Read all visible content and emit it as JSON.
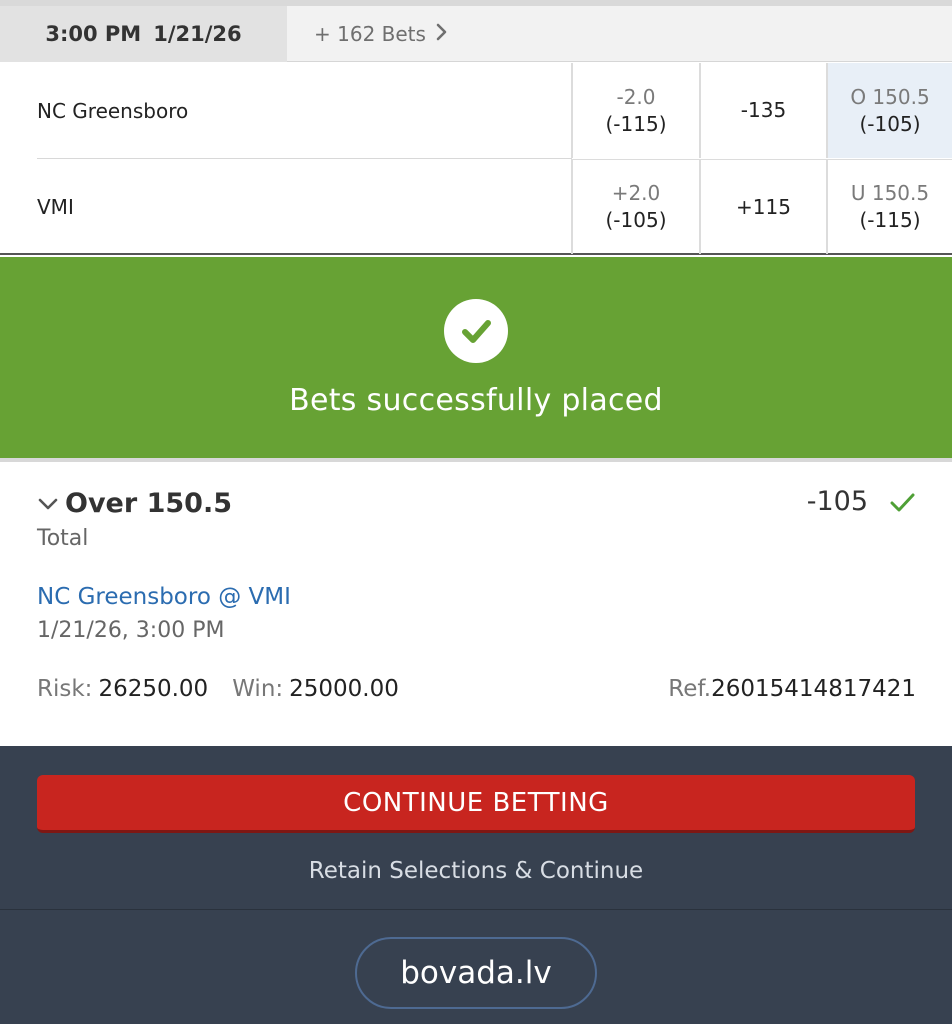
{
  "header": {
    "time": "3:00 PM",
    "date": "1/21/26",
    "more_bets": "+ 162 Bets"
  },
  "odds_table": {
    "rows": [
      {
        "team": "NC Greensboro",
        "spread_points": "-2.0",
        "spread_price": "(-115)",
        "moneyline": "-135",
        "total_points": "O 150.5",
        "total_price": "(-105)",
        "total_selected": true
      },
      {
        "team": "VMI",
        "spread_points": "+2.0",
        "spread_price": "(-105)",
        "moneyline": "+115",
        "total_points": "U 150.5",
        "total_price": "(-115)",
        "total_selected": false
      }
    ]
  },
  "banner": {
    "message": "Bets successfully placed",
    "icon": "check-circle-icon",
    "color": "#67a234"
  },
  "bet": {
    "selection": "Over 150.5",
    "odds": "-105",
    "market": "Total",
    "matchup": "NC Greensboro @ VMI",
    "datetime": "1/21/26, 3:00 PM",
    "risk_label": "Risk:",
    "risk_value": "26250.00",
    "win_label": "Win:",
    "win_value": "25000.00",
    "ref_label": "Ref.",
    "ref_value": "26015414817421"
  },
  "footer": {
    "continue_label": "CONTINUE BETTING",
    "retain_label": "Retain Selections & Continue",
    "site": "bovada.lv",
    "button_color": "#c8251f"
  }
}
